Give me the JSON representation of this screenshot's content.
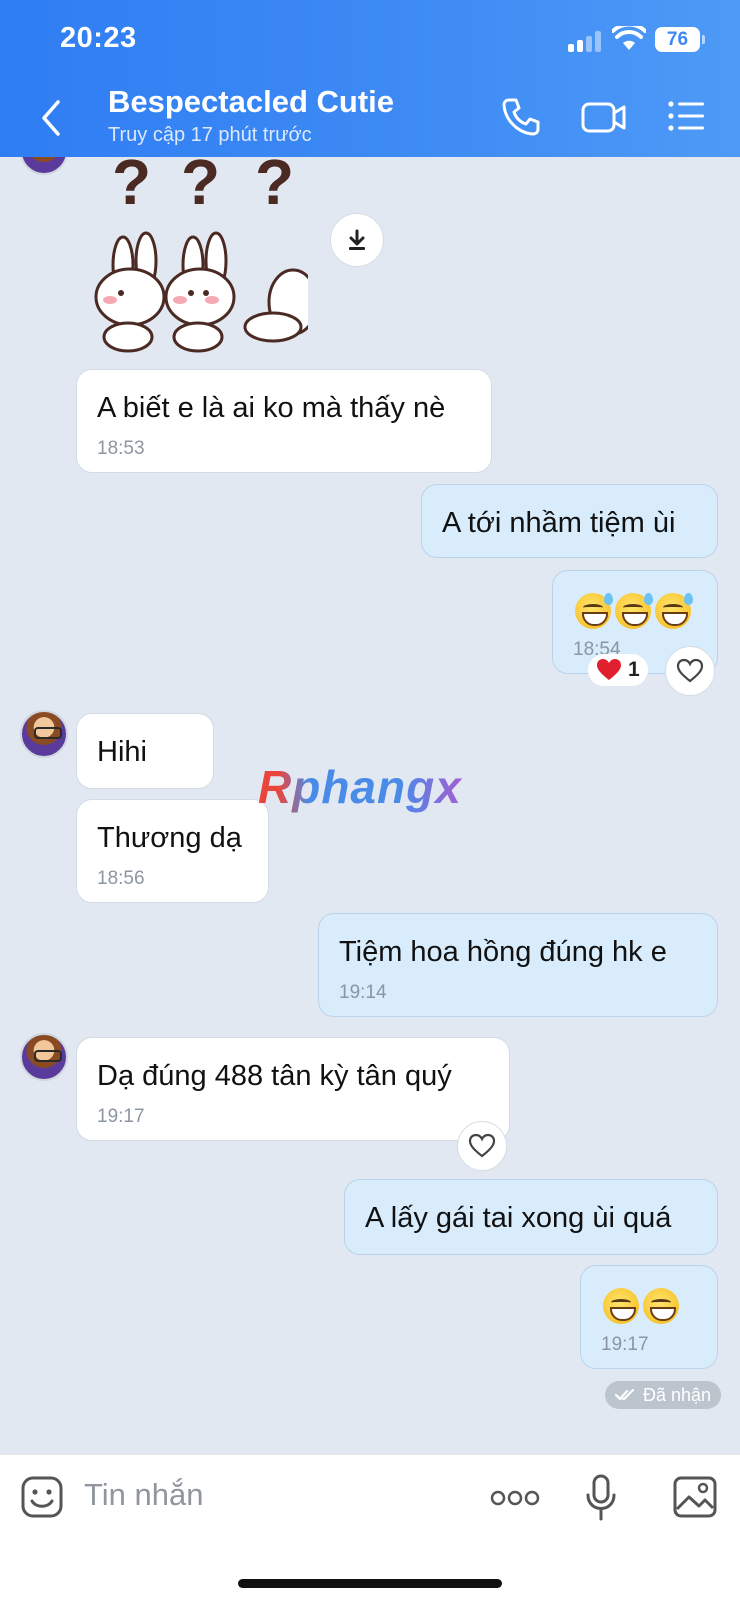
{
  "status_bar": {
    "time": "20:23",
    "battery": "76"
  },
  "header": {
    "title": "Bespectacled Cutie",
    "subtitle": "Truy cập 17 phút trước"
  },
  "messages": [
    {
      "dir": "in",
      "text": "A biết e là ai ko mà thấy nè",
      "time": "18:53"
    },
    {
      "dir": "out",
      "text": "A tới nhầm tiệm ùi"
    },
    {
      "dir": "out",
      "emoji": "😅😅😅",
      "time": "18:54",
      "reaction": {
        "emoji": "heart",
        "count": "1"
      }
    },
    {
      "dir": "in",
      "text": "Hihi"
    },
    {
      "dir": "in",
      "text": "Thương dạ",
      "time": "18:56"
    },
    {
      "dir": "out",
      "text": "Tiệm hoa hồng đúng hk e",
      "time": "19:14"
    },
    {
      "dir": "in",
      "text": "Dạ đúng 488 tân kỳ tân quý",
      "time": "19:17"
    },
    {
      "dir": "out",
      "text": "A lấy gái tai xong ùi quá"
    },
    {
      "dir": "out",
      "emoji": "😁😁",
      "time": "19:17"
    }
  ],
  "sticker": {
    "marks": [
      "?",
      "?",
      "?"
    ]
  },
  "watermark": "Rphangx",
  "delivery_status": "Đã nhận",
  "input": {
    "placeholder": "Tin nhắn"
  },
  "colors": {
    "header": "#3d88f4",
    "incoming_bubble": "#ffffff",
    "outgoing_bubble": "#d8ecfc",
    "background": "#e2e8f1",
    "reaction_heart": "#e0202e"
  }
}
